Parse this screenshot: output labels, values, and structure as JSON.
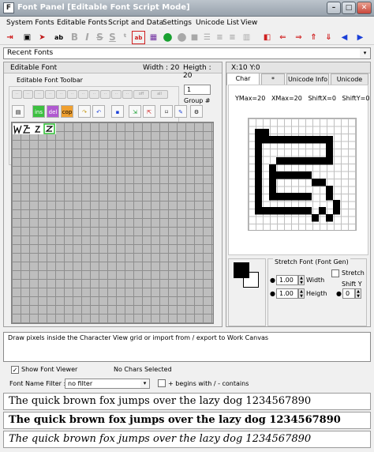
{
  "window": {
    "title": "Font Panel [Editable Font Script Mode]",
    "controls": {
      "minimize": "–",
      "maximize": "□",
      "close": "✕"
    }
  },
  "menu": [
    "System Fonts",
    "Editable Fonts",
    "Script and Data",
    "Settings",
    "Unicode List",
    "View"
  ],
  "toolbar_glyphs": {
    "bold": "B",
    "italic": "I",
    "strike": "S",
    "under": "S",
    "ab": "ab",
    "ab2": "ab"
  },
  "recent": {
    "label": "Recent Fonts",
    "arrow": "▾"
  },
  "font_info": {
    "name": "Editable Font",
    "width": "Width : 20",
    "height": "Heigth : 20",
    "pos": "X:10  Y:0"
  },
  "editable_toolbar": {
    "label": "Editable Font Toolbar",
    "group_value": "1",
    "group_label": "Group #",
    "ins": "ins",
    "del": "del",
    "cop": "cop"
  },
  "tabs": [
    "Char View",
    "*",
    "Unicode Info",
    "Unicode List"
  ],
  "char_view": {
    "metrics": "YMax=20   XMax=20   ShiftX=0   ShiftY=0"
  },
  "stretch": {
    "label": "Stretch Font (Font Gen)",
    "stretch_label": "Stretch",
    "width_value": "1.00",
    "width_label": "Width",
    "height_value": "1.00",
    "height_label": "Heigth",
    "shift_y_label": "Shift Y",
    "shift_y_value": "0"
  },
  "status": {
    "message": "Draw pixels inside the Character View grid or import from / export to Work Canvas"
  },
  "viewer": {
    "show_label": "Show Font Viewer",
    "selection": "No Chars Selected"
  },
  "filter": {
    "label": "Font Name Filter :",
    "value": "no filter",
    "hint": "+ begins with / - contains"
  },
  "samples": [
    "The quick brown fox jumps over the lazy dog 1234567890",
    "The quick brown fox jumps over the lazy dog 1234567890",
    "The quick brown fox jumps over the lazy dog 1234567890"
  ],
  "colors": {
    "foreground": "#000000",
    "background": "#ffffff",
    "accent_red": "#d02020",
    "accent_blue": "#1a3fd8"
  }
}
